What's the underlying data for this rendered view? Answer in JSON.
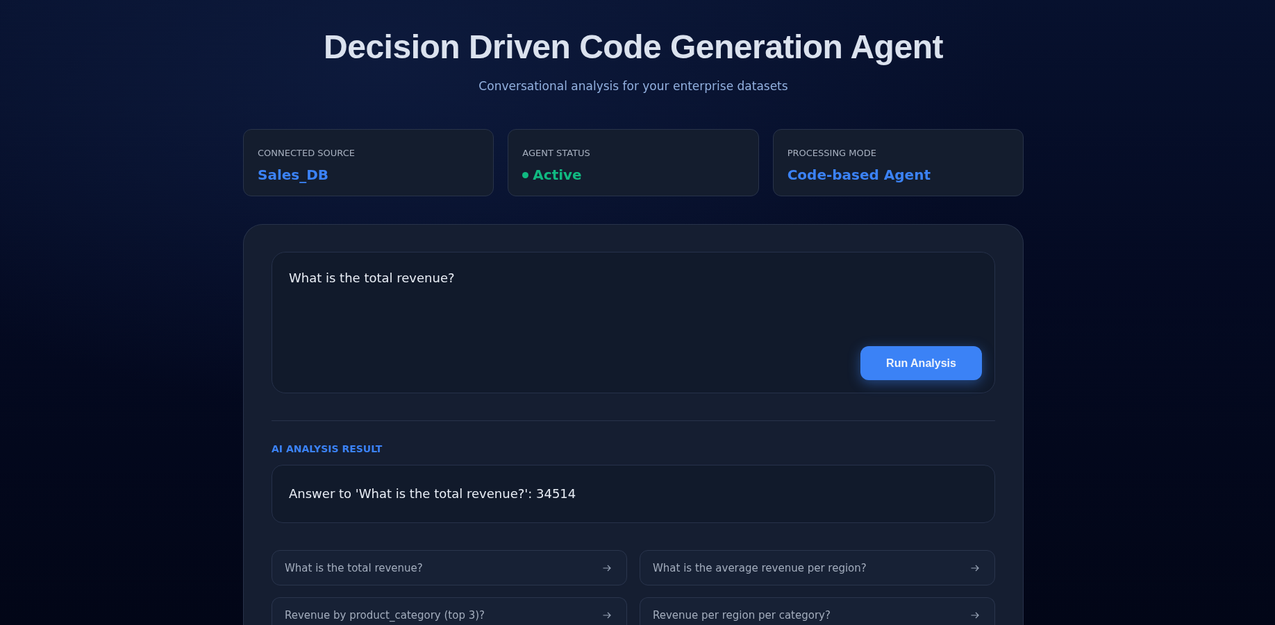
{
  "header": {
    "title": "Decision Driven Code Generation Agent",
    "subtitle": "Conversational analysis for your enterprise datasets"
  },
  "status_cards": [
    {
      "label": "CONNECTED SOURCE",
      "value": "Sales_DB",
      "kind": "plain",
      "color": "#3b82f6"
    },
    {
      "label": "AGENT STATUS",
      "value": "Active",
      "kind": "status",
      "color": "#10b981"
    },
    {
      "label": "PROCESSING MODE",
      "value": "Code-based Agent",
      "kind": "plain",
      "color": "#3b82f6"
    }
  ],
  "query": {
    "value": "What is the total revenue?",
    "button": "Run Analysis"
  },
  "result": {
    "heading": "AI ANALYSIS RESULT",
    "answer": "Answer to 'What is the total revenue?': 34514"
  },
  "suggestions": [
    {
      "label": "What is the total revenue?"
    },
    {
      "label": "What is the average revenue per region?"
    },
    {
      "label": "Revenue by product_category (top 3)?"
    },
    {
      "label": "Revenue per region per category?"
    }
  ]
}
